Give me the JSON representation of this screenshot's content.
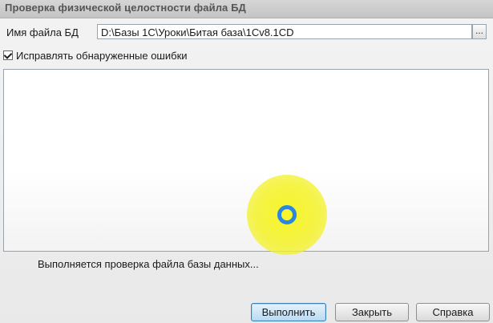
{
  "window": {
    "title": "Проверка физической целостности файла БД"
  },
  "form": {
    "file_label": "Имя файла БД",
    "file_value": "D:\\Базы 1С\\Уроки\\Битая база\\1Cv8.1CD",
    "browse_label": "...",
    "fix_errors_label": "Исправлять обнаруженные ошибки",
    "fix_errors_checked": true
  },
  "status": {
    "text": "Выполняется проверка файла базы данных..."
  },
  "buttons": {
    "run": "Выполнить",
    "close": "Закрыть",
    "help": "Справка"
  },
  "colors": {
    "cursor_highlight": "#f8f51e",
    "cursor_ring": "#2a86e0",
    "default_button_border": "#3c7fb1"
  }
}
